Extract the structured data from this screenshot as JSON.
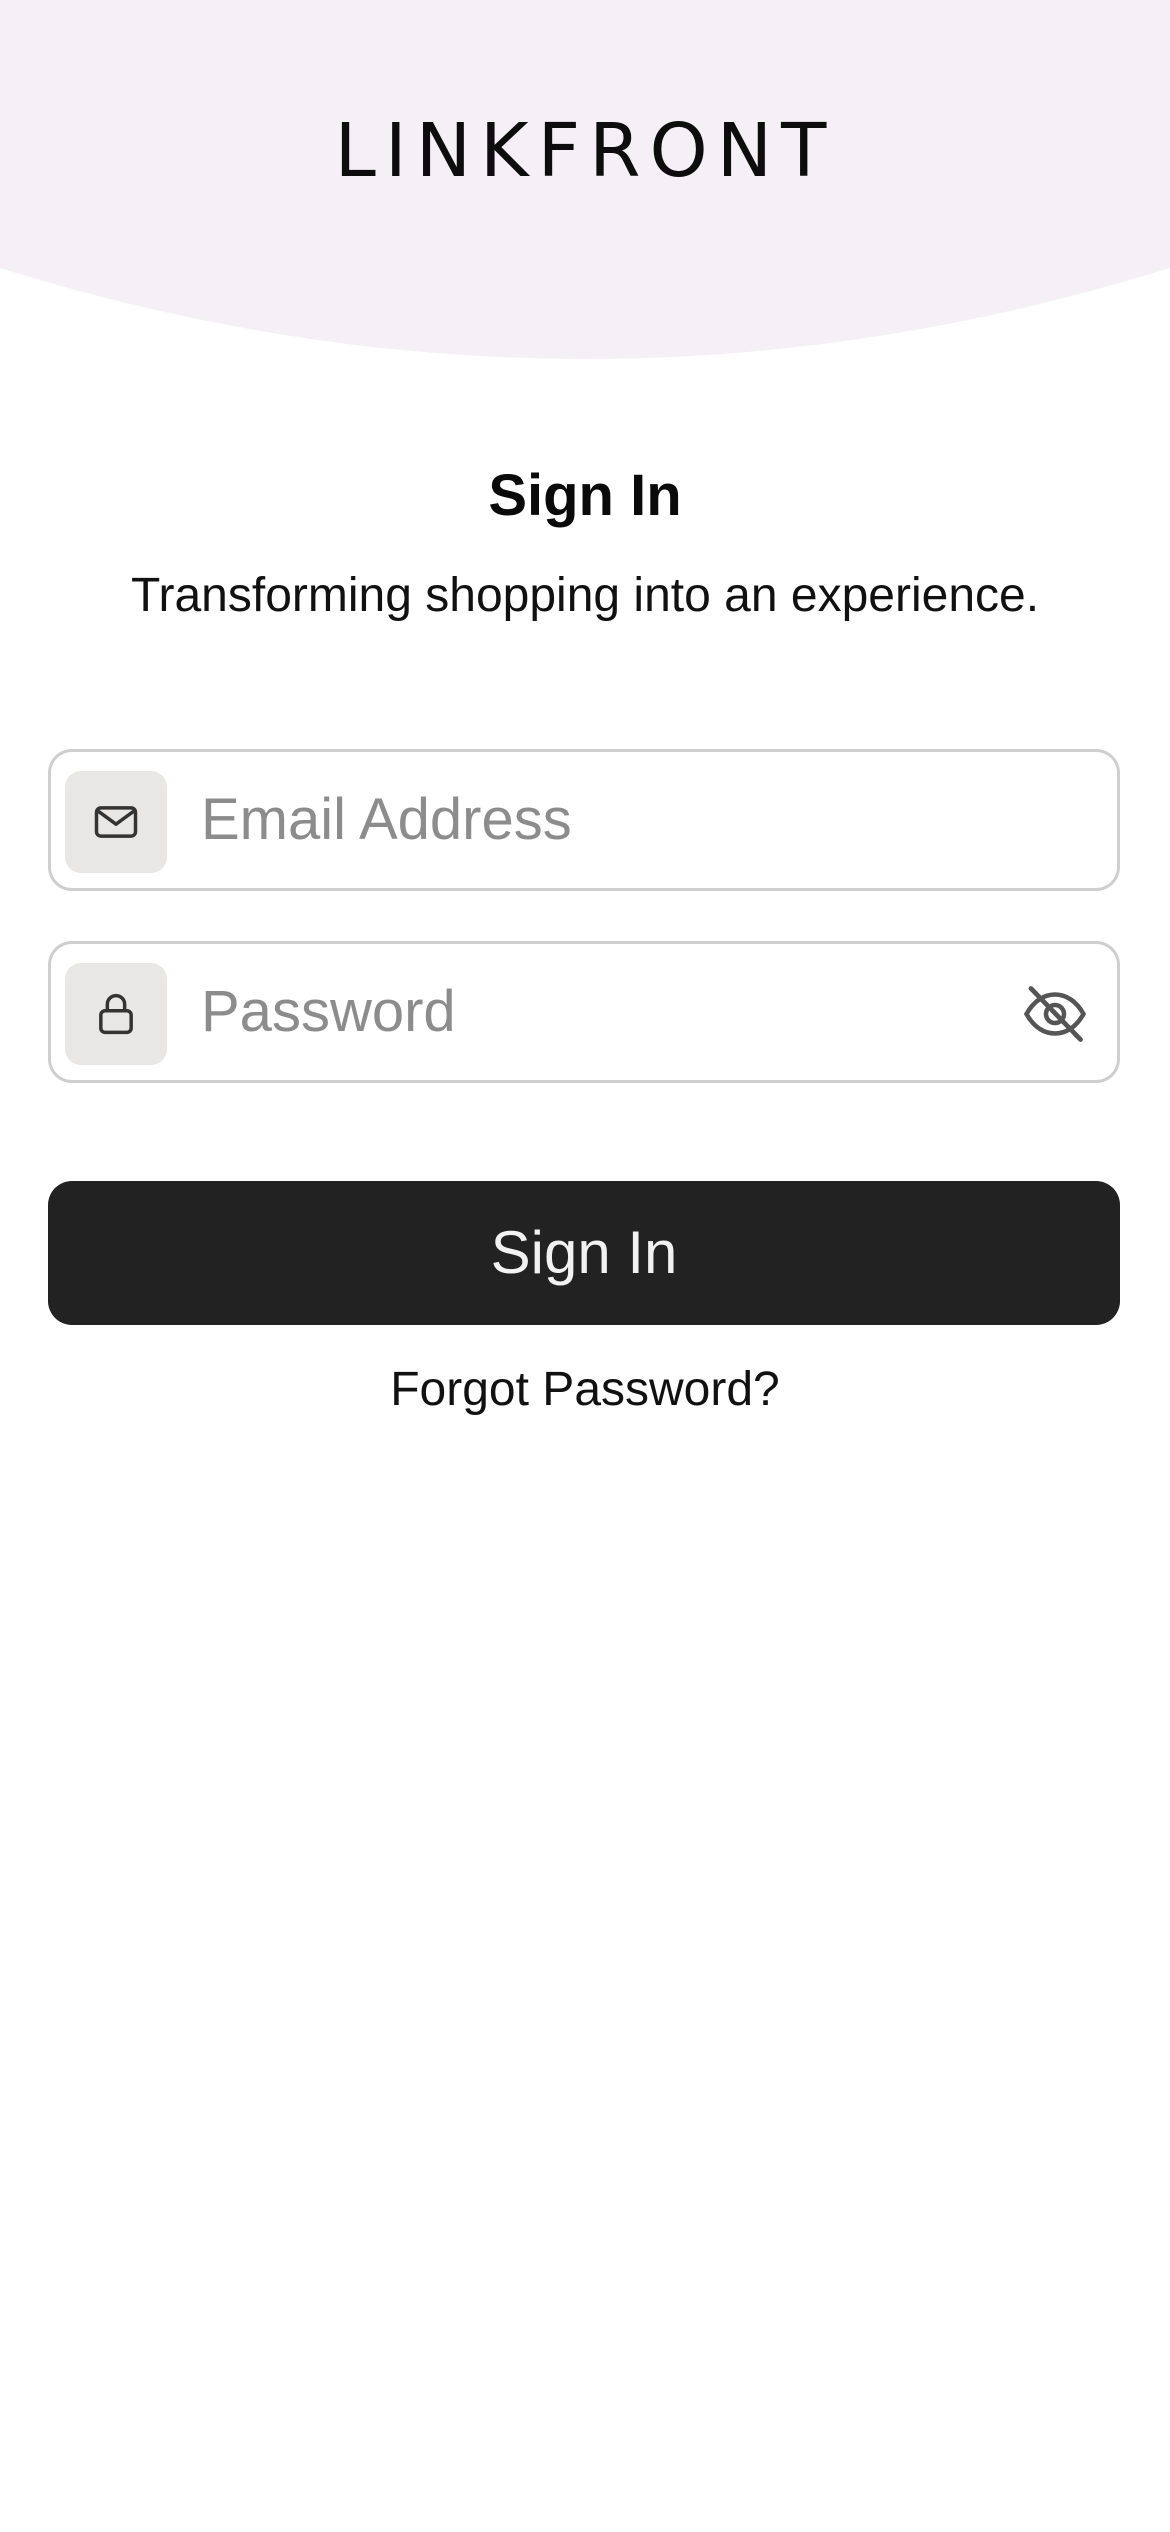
{
  "brand": {
    "logo_text": "LINKFRONT"
  },
  "signin": {
    "title": "Sign In",
    "subtitle": "Transforming shopping into an experience."
  },
  "form": {
    "email": {
      "placeholder": "Email Address",
      "icon": "mail-icon"
    },
    "password": {
      "placeholder": "Password",
      "icon": "lock-icon",
      "toggle_icon": "eye-off-icon"
    },
    "submit_label": "Sign In",
    "forgot_label": "Forgot Password?"
  },
  "colors": {
    "header_bg": "#f5f0f6",
    "button_bg": "#222222",
    "button_text": "#f2f2f2",
    "icon_box_bg": "#e8e7e6",
    "field_border": "#cfcfcf",
    "placeholder": "#8c8c8c"
  }
}
